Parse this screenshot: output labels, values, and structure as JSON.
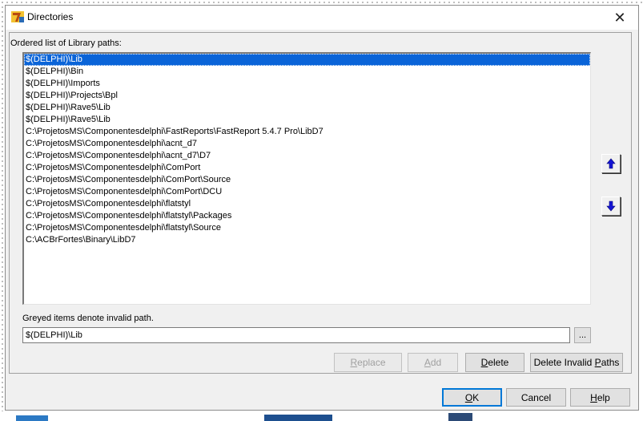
{
  "window": {
    "title": "Directories",
    "close_glyph": "✕"
  },
  "list_label": "Ordered list of Library paths:",
  "paths": [
    "$(DELPHI)\\Lib",
    "$(DELPHI)\\Bin",
    "$(DELPHI)\\Imports",
    "$(DELPHI)\\Projects\\Bpl",
    "$(DELPHI)\\Rave5\\Lib",
    "$(DELPHI)\\Rave5\\Lib",
    "C:\\ProjetosMS\\Componentesdelphi\\FastReports\\FastReport 5.4.7 Pro\\LibD7",
    "C:\\ProjetosMS\\Componentesdelphi\\acnt_d7",
    "C:\\ProjetosMS\\Componentesdelphi\\acnt_d7\\D7",
    "C:\\ProjetosMS\\Componentesdelphi\\ComPort",
    "C:\\ProjetosMS\\Componentesdelphi\\ComPort\\Source",
    "C:\\ProjetosMS\\Componentesdelphi\\ComPort\\DCU",
    "C:\\ProjetosMS\\Componentesdelphi\\flatstyl",
    "C:\\ProjetosMS\\Componentesdelphi\\flatstyl\\Packages",
    "C:\\ProjetosMS\\Componentesdelphi\\flatstyl\\Source",
    "C:\\ACBrFortes\\Binary\\LibD7"
  ],
  "selected_index": 0,
  "hint_label": "Greyed items denote invalid path.",
  "path_input": {
    "value": "$(DELPHI)\\Lib"
  },
  "browse_label": "...",
  "buttons": {
    "replace": {
      "mnemonic": "R",
      "rest": "eplace"
    },
    "add": {
      "mnemonic": "A",
      "rest": "dd"
    },
    "delete": {
      "mnemonic": "D",
      "rest": "elete"
    },
    "delete_invalid": {
      "before": "Delete Invalid ",
      "mnemonic": "P",
      "rest": "aths"
    },
    "ok": {
      "mnemonic": "O",
      "rest": "K"
    },
    "cancel": {
      "label": "Cancel"
    },
    "help": {
      "mnemonic": "H",
      "rest": "elp"
    }
  },
  "icons": {
    "move_up": "move-up-arrow-icon",
    "move_down": "move-down-arrow-icon",
    "app": "delphi-app-icon"
  },
  "colors": {
    "selection": "#0a64d8",
    "arrow": "#1414d4",
    "default_border": "#0078d7"
  }
}
